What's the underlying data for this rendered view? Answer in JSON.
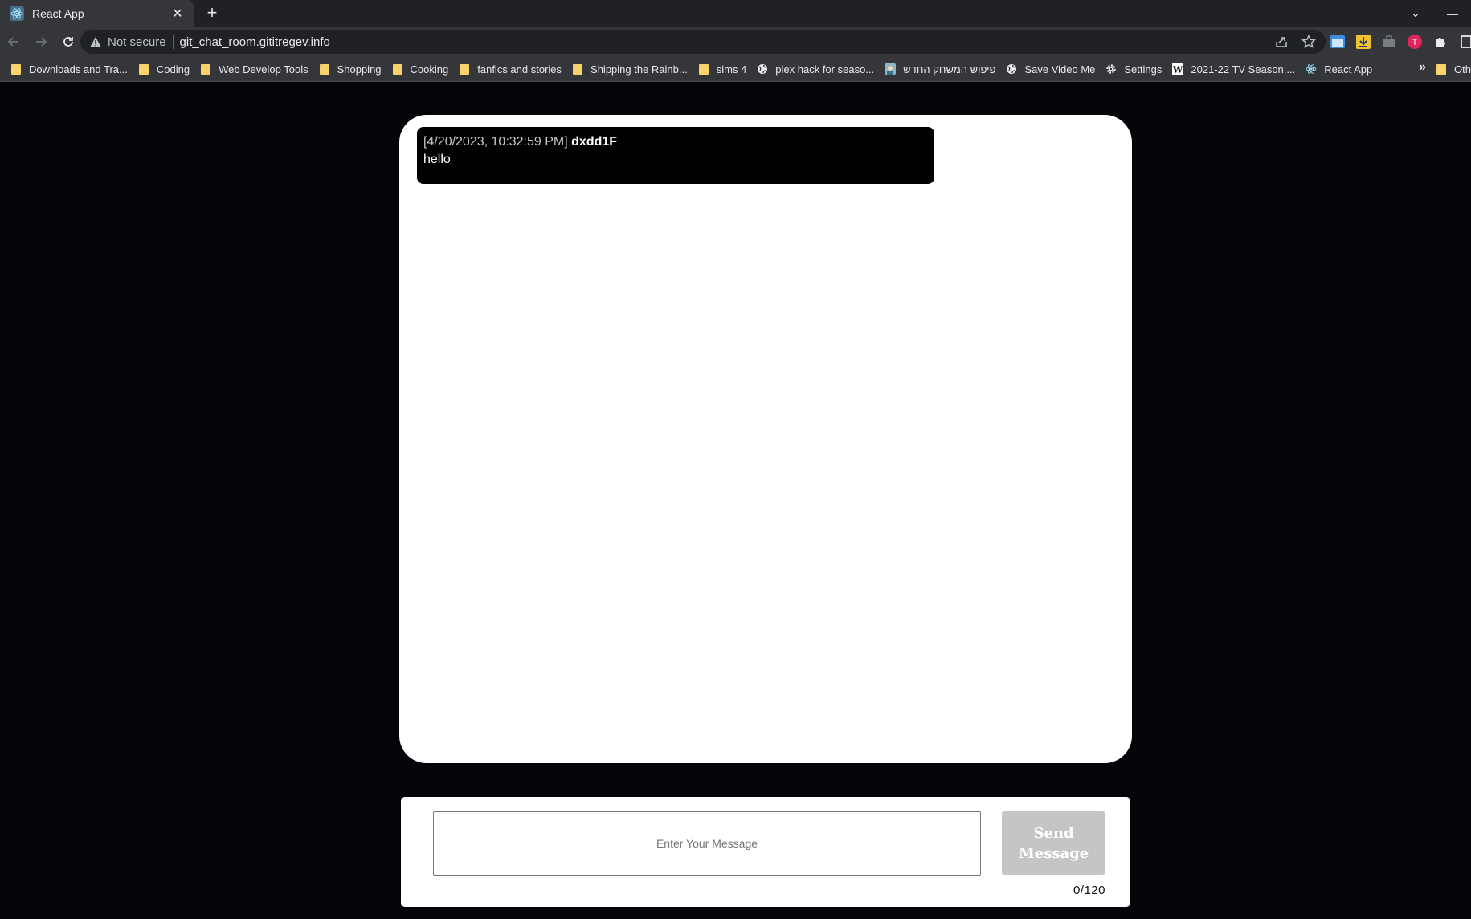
{
  "browser": {
    "tab": {
      "title": "React App",
      "close_glyph": "✕",
      "favicon": "react-icon"
    },
    "new_tab_glyph": "+",
    "window_controls": {
      "dropdown": "⌄",
      "minimize": "—"
    },
    "nav": {
      "back": "back-arrow-icon",
      "forward": "forward-arrow-icon",
      "reload": "reload-icon"
    },
    "omnibox": {
      "security_label": "Not secure",
      "url": "git_chat_room.gititregev.info"
    },
    "bookmarks": [
      {
        "label": "Downloads and Tra...",
        "icon": "folder"
      },
      {
        "label": "Coding",
        "icon": "folder"
      },
      {
        "label": "Web Develop Tools",
        "icon": "folder"
      },
      {
        "label": "Shopping",
        "icon": "folder"
      },
      {
        "label": "Cooking",
        "icon": "folder"
      },
      {
        "label": "fanfics and stories",
        "icon": "folder"
      },
      {
        "label": "Shipping the Rainb...",
        "icon": "folder"
      },
      {
        "label": "sims 4",
        "icon": "folder"
      },
      {
        "label": "plex hack for seaso...",
        "icon": "globe"
      },
      {
        "label": "פיפוש המשחק החדש",
        "icon": "image"
      },
      {
        "label": "Save Video Me",
        "icon": "globe"
      },
      {
        "label": "Settings",
        "icon": "gear"
      },
      {
        "label": "2021-22 TV Season:...",
        "icon": "w"
      },
      {
        "label": "React App",
        "icon": "react"
      }
    ],
    "bookmarks_more": "»",
    "bookmarks_other": "Oth"
  },
  "chat": {
    "messages": [
      {
        "timestamp": "[4/20/2023, 10:32:59 PM]",
        "user": "dxdd1F",
        "text": "hello"
      }
    ]
  },
  "composer": {
    "placeholder": "Enter Your Message",
    "value": "",
    "send_label": "Send Message",
    "counter": "0/120"
  },
  "colors": {
    "page_bg": "#060408",
    "chat_bg": "#ffffff",
    "message_bg": "#000000",
    "send_button_bg": "#c5c5c5"
  }
}
